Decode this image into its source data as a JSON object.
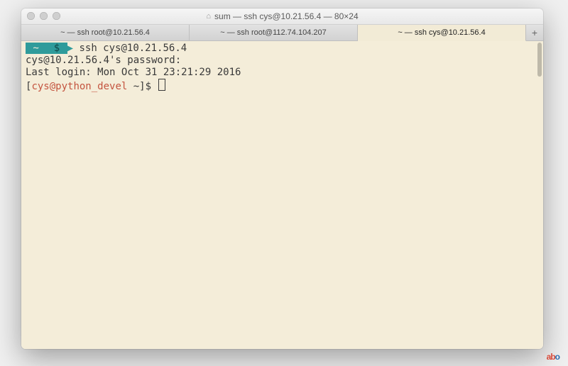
{
  "window": {
    "title": "sum — ssh cys@10.21.56.4 — 80×24"
  },
  "tabs": [
    {
      "label": "~ — ssh root@10.21.56.4",
      "active": false
    },
    {
      "label": "~ — ssh root@112.74.104.207",
      "active": false
    },
    {
      "label": "~ — ssh cys@10.21.56.4",
      "active": true
    }
  ],
  "add_tab_label": "+",
  "terminal": {
    "prompt_tilde": " ~ ",
    "prompt_dollar": " $ ",
    "command": "ssh cys@10.21.56.4",
    "line2": "cys@10.21.56.4's password:",
    "line3": "Last login: Mon Oct 31 23:21:29 2016",
    "line4_open": "[",
    "line4_user": "cys@python_devel",
    "line4_path": " ~",
    "line4_close": "]$ "
  },
  "watermark": {
    "a": "ab",
    "b": "o"
  }
}
